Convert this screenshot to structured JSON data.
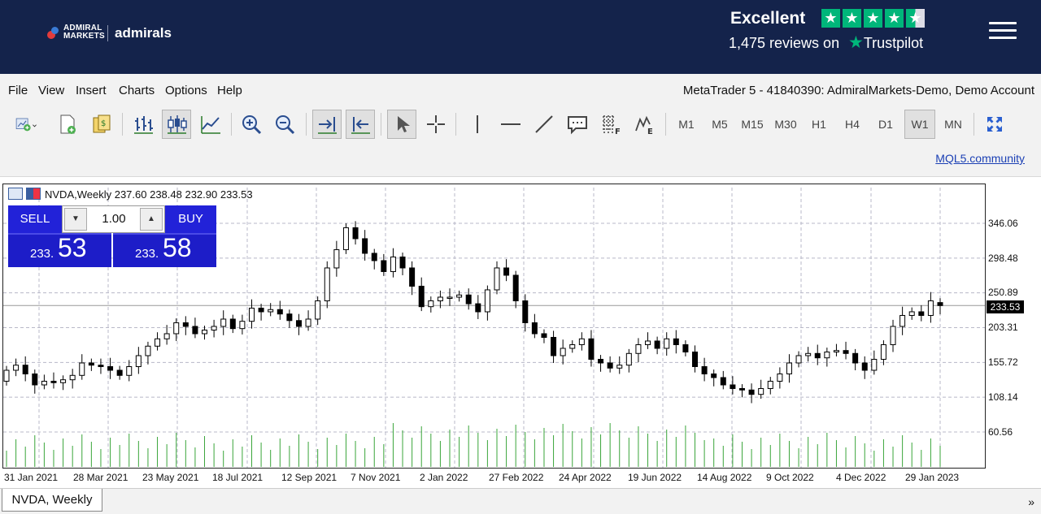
{
  "header": {
    "logo_admiral": "ADMIRAL",
    "logo_markets": "MARKETS",
    "logo_admirals": "admirals",
    "rating_word": "Excellent",
    "stars": 4.5,
    "reviews_text": "1,475 reviews on",
    "trustpilot": "Trustpilot",
    "menu_icon": "hamburger-icon"
  },
  "menubar": {
    "items": [
      "File",
      "View",
      "Insert",
      "Charts",
      "Options",
      "Help"
    ],
    "account": "MetaTrader 5 - 41840390: AdmiralMarkets-Demo, Demo Account"
  },
  "toolbar": {
    "icons": [
      "new-chart-icon",
      "new-document-icon",
      "market-watch-icon",
      "bar-chart-icon",
      "candlestick-icon",
      "line-chart-icon",
      "zoom-in-icon",
      "zoom-out-icon",
      "autoscroll-icon",
      "chart-shift-icon",
      "cursor-icon",
      "crosshair-icon",
      "vertical-line-icon",
      "horizontal-line-icon",
      "trendline-icon",
      "text-icon",
      "fibonacci-icon",
      "elliott-icon",
      "fullscreen-icon"
    ],
    "timeframes": [
      "M1",
      "M5",
      "M15",
      "M30",
      "H1",
      "H4",
      "D1",
      "W1",
      "MN"
    ],
    "active_timeframe": "W1",
    "community_link": "MQL5.community"
  },
  "chart": {
    "header": "NVDA,Weekly  237.60 238.48 232.90 233.53",
    "sell_label": "SELL",
    "buy_label": "BUY",
    "lot": "1.00",
    "sell_small": "233.",
    "sell_big": "53",
    "buy_small": "233.",
    "buy_big": "58",
    "current_price": "233.53",
    "tab_label": "NVDA, Weekly",
    "scroll_arrow": "»"
  },
  "chart_data": {
    "type": "candlestick",
    "symbol": "NVDA",
    "timeframe": "Weekly",
    "y_ticks": [
      "346.06",
      "298.48",
      "250.89",
      "203.31",
      "155.72",
      "108.14",
      "60.56"
    ],
    "x_ticks": [
      "31 Jan 2021",
      "28 Mar 2021",
      "23 May 2021",
      "18 Jul 2021",
      "12 Sep 2021",
      "7 Nov 2021",
      "2 Jan 2022",
      "27 Feb 2022",
      "24 Apr 2022",
      "19 Jun 2022",
      "14 Aug 2022",
      "9 Oct 2022",
      "4 Dec 2022",
      "29 Jan 2023"
    ],
    "ylim": [
      40,
      375
    ],
    "close": [
      145,
      152,
      140,
      125,
      130,
      128,
      132,
      138,
      155,
      152,
      150,
      145,
      138,
      150,
      165,
      178,
      188,
      195,
      210,
      205,
      195,
      200,
      205,
      215,
      202,
      212,
      230,
      225,
      228,
      222,
      213,
      205,
      215,
      240,
      285,
      310,
      340,
      325,
      305,
      295,
      280,
      300,
      285,
      260,
      232,
      240,
      245,
      245,
      248,
      236,
      225,
      255,
      285,
      275,
      240,
      210,
      195,
      190,
      165,
      175,
      180,
      188,
      160,
      155,
      148,
      152,
      168,
      180,
      185,
      175,
      188,
      180,
      170,
      150,
      140,
      135,
      125,
      120,
      118,
      112,
      120,
      130,
      140,
      155,
      165,
      168,
      162,
      170,
      172,
      168,
      155,
      145,
      160,
      180,
      205,
      220,
      225,
      220,
      240,
      233.53
    ],
    "open": [
      130,
      145,
      152,
      140,
      125,
      130,
      128,
      132,
      138,
      155,
      152,
      150,
      145,
      138,
      150,
      165,
      178,
      188,
      195,
      210,
      205,
      195,
      200,
      205,
      215,
      202,
      212,
      230,
      225,
      228,
      222,
      213,
      205,
      215,
      240,
      285,
      310,
      340,
      325,
      305,
      295,
      280,
      300,
      285,
      260,
      232,
      240,
      245,
      245,
      248,
      236,
      225,
      255,
      285,
      275,
      240,
      210,
      195,
      190,
      165,
      175,
      180,
      188,
      160,
      155,
      148,
      152,
      168,
      180,
      185,
      175,
      188,
      180,
      170,
      150,
      140,
      135,
      125,
      120,
      118,
      112,
      120,
      130,
      140,
      155,
      165,
      168,
      162,
      170,
      172,
      168,
      155,
      145,
      160,
      180,
      205,
      220,
      225,
      220,
      237.6
    ],
    "volume_label": "histogram (volume)",
    "current_price": 233.53
  }
}
